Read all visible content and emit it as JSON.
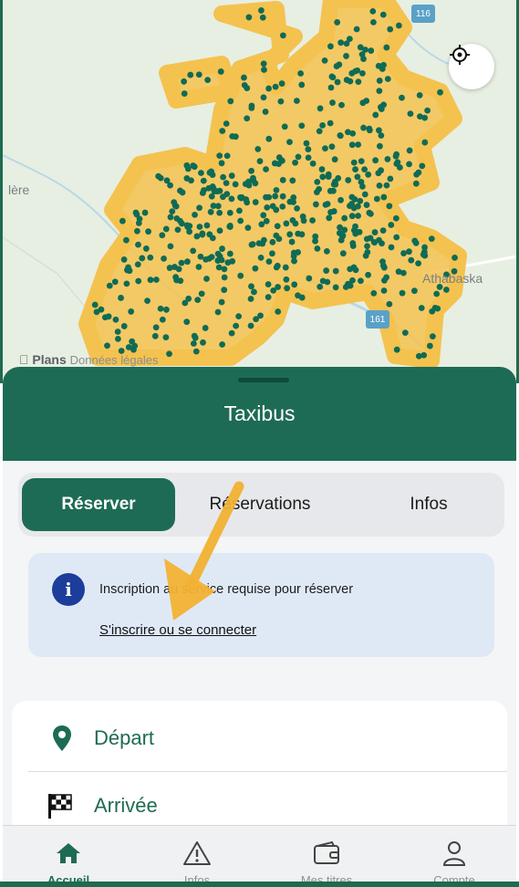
{
  "map": {
    "labels": [
      "lère",
      "Athabaska",
      "116",
      "161"
    ],
    "legal": "Plans",
    "legal_small": "Données légales",
    "locate_icon": "locate-crosshair-icon",
    "colors": {
      "zone": "#f4c24f",
      "stops": "#0f6b55",
      "land": "#e7efe2"
    }
  },
  "sheet": {
    "title": "Taxibus"
  },
  "tabs": [
    {
      "label": "Réserver",
      "active": true
    },
    {
      "label": "Réservations",
      "active": false
    },
    {
      "label": "Infos",
      "active": false
    }
  ],
  "notice": {
    "text": "Inscription au service requise pour réserver",
    "link": "S'inscrire ou se connecter"
  },
  "form": {
    "departure": "Départ",
    "arrival": "Arrivée"
  },
  "nav": [
    {
      "label": "Accueil",
      "icon": "home-icon",
      "active": true
    },
    {
      "label": "Infos",
      "icon": "warning-icon",
      "active": false
    },
    {
      "label": "Mes titres",
      "icon": "wallet-icon",
      "active": false
    },
    {
      "label": "Compte",
      "icon": "user-icon",
      "active": false
    }
  ],
  "colors": {
    "brand": "#1e6b55",
    "notice_bg": "#dfe9f6",
    "info": "#1c3d9a",
    "arrow": "#f2b233"
  }
}
